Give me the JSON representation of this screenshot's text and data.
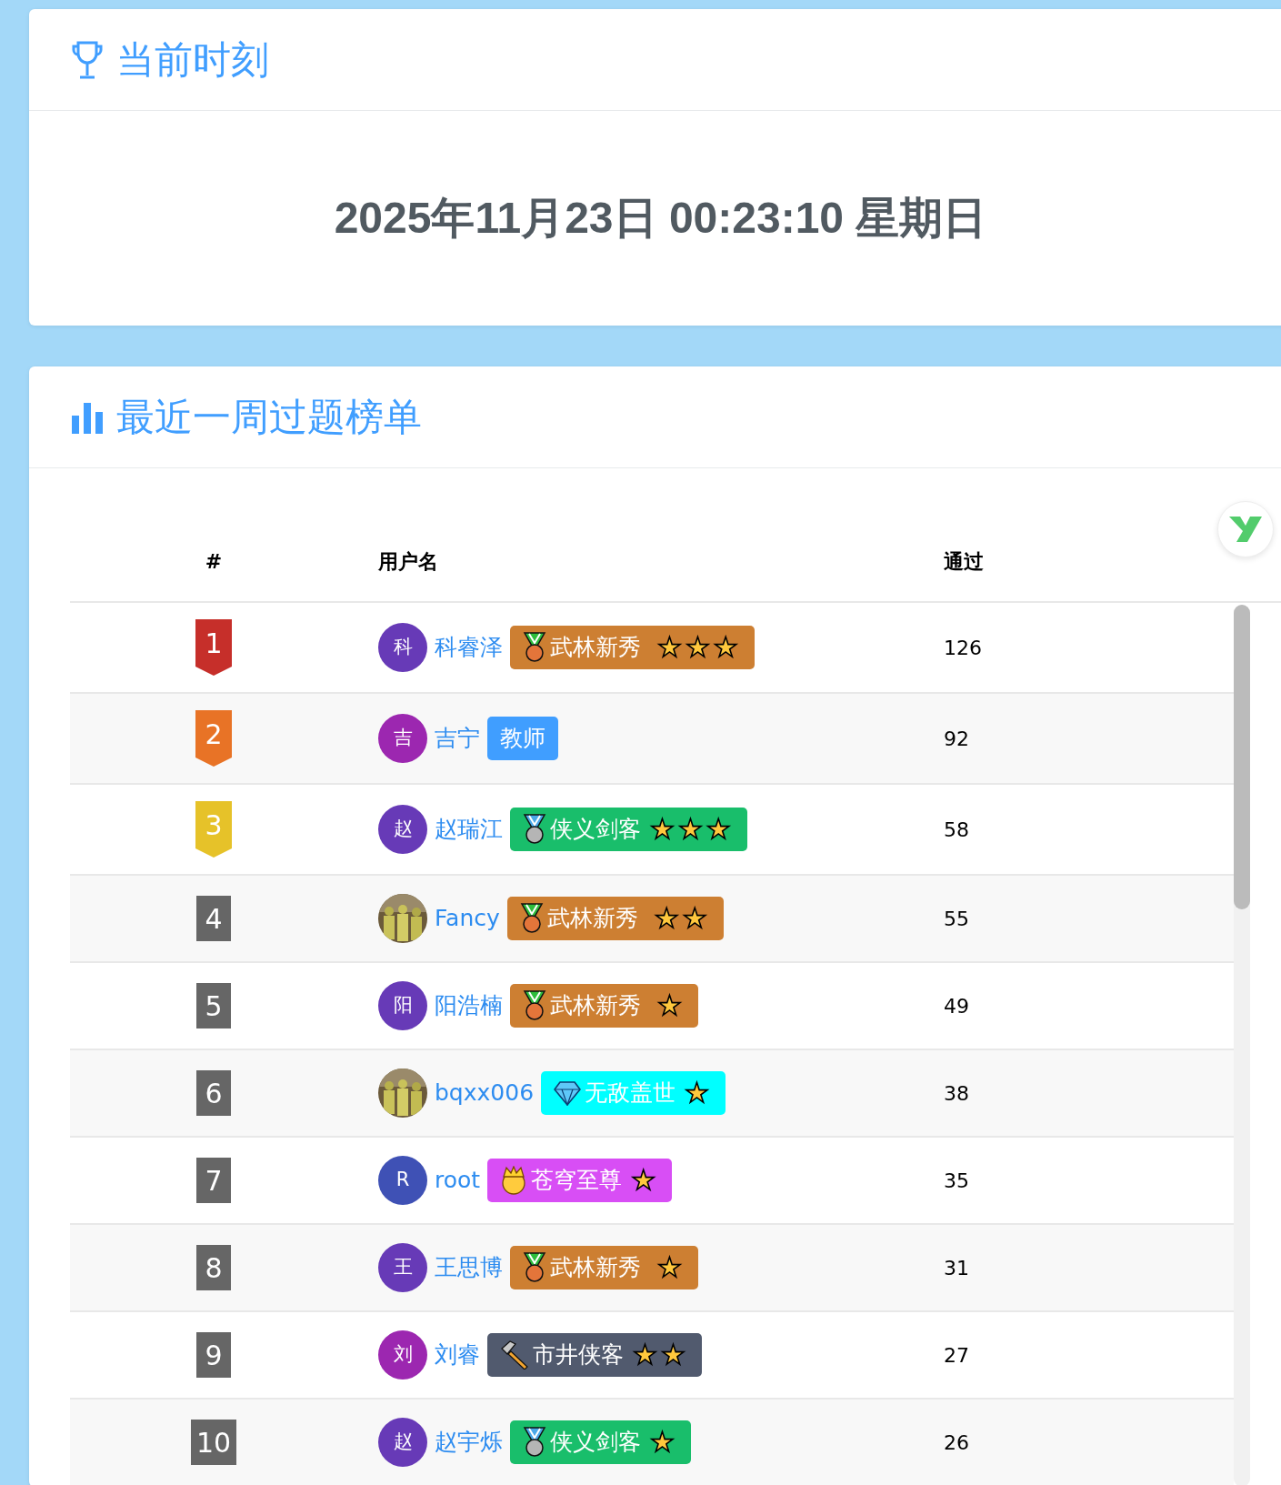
{
  "clock_card": {
    "title": "当前时刻",
    "datetime": "2025年11月23日 00:23:10 星期日"
  },
  "ranking_card": {
    "title": "最近一周过题榜单",
    "table": {
      "columns": [
        "#",
        "用户名",
        "通过"
      ],
      "rows": [
        {
          "rank": {
            "text": "1",
            "kind": "ribbon",
            "color": "#c62f2a"
          },
          "avatar": {
            "kind": "letter",
            "text": "科",
            "color": "#673ab7"
          },
          "username": "科睿泽",
          "badge": {
            "kind": "bronze",
            "text": "武林新秀",
            "color": "#cd7f32",
            "star_marks": "★★★"
          },
          "passed": "126"
        },
        {
          "rank": {
            "text": "2",
            "kind": "ribbon",
            "color": "#e87326"
          },
          "avatar": {
            "kind": "letter",
            "text": "吉",
            "color": "#9c27b0"
          },
          "username": "吉宁",
          "badge": {
            "kind": "plain",
            "text": "教师",
            "color": "#409eff"
          },
          "passed": "92"
        },
        {
          "rank": {
            "text": "3",
            "kind": "ribbon",
            "color": "#e6c229"
          },
          "avatar": {
            "kind": "letter",
            "text": "赵",
            "color": "#673ab7"
          },
          "username": "赵瑞江",
          "badge": {
            "kind": "silver",
            "text": "侠义剑客",
            "color": "#19be6b",
            "star_marks": "★★★"
          },
          "passed": "58"
        },
        {
          "rank": {
            "text": "4",
            "kind": "box",
            "color": "#666666"
          },
          "username": "Fancy",
          "badge": {
            "kind": "bronze",
            "text": "武林新秀",
            "color": "#cd7f32",
            "star_marks": "★★"
          },
          "passed": "55"
        },
        {
          "rank": {
            "text": "5",
            "kind": "box",
            "color": "#666666"
          },
          "avatar": {
            "kind": "letter",
            "text": "阳",
            "color": "#673ab7"
          },
          "username": "阳浩楠",
          "badge": {
            "kind": "bronze",
            "text": "武林新秀",
            "color": "#cd7f32",
            "star_marks": "★"
          },
          "passed": "49"
        },
        {
          "rank": {
            "text": "6",
            "kind": "box",
            "color": "#666666"
          },
          "username": "bqxx006",
          "badge": {
            "kind": "diamond",
            "text": "无敌盖世",
            "color": "#00ffff",
            "star_marks": "★"
          },
          "passed": "38"
        },
        {
          "rank": {
            "text": "7",
            "kind": "box",
            "color": "#666666"
          },
          "avatar": {
            "kind": "letter",
            "text": "R",
            "color": "#3f51b5"
          },
          "username": "root",
          "badge": {
            "kind": "crown",
            "text": "苍穹至尊",
            "color": "#d84ef5",
            "star_marks": "★"
          },
          "passed": "35"
        },
        {
          "rank": {
            "text": "8",
            "kind": "box",
            "color": "#666666"
          },
          "avatar": {
            "kind": "letter",
            "text": "王",
            "color": "#673ab7"
          },
          "username": "王思博",
          "badge": {
            "kind": "bronze",
            "text": "武林新秀",
            "color": "#cd7f32",
            "star_marks": "★"
          },
          "passed": "31"
        },
        {
          "rank": {
            "text": "9",
            "kind": "box",
            "color": "#666666"
          },
          "avatar": {
            "kind": "letter",
            "text": "刘",
            "color": "#9c27b0"
          },
          "username": "刘睿",
          "badge": {
            "kind": "hammer",
            "text": "市井侠客",
            "color": "#515a6e",
            "star_marks": "★★"
          },
          "passed": "27"
        },
        {
          "rank": {
            "text": "10",
            "kind": "box",
            "color": "#666666"
          },
          "avatar": {
            "kind": "letter",
            "text": "赵",
            "color": "#673ab7"
          },
          "username": "赵宇烁",
          "badge": {
            "kind": "silver",
            "text": "侠义剑客",
            "color": "#19be6b",
            "star_marks": "★"
          },
          "passed": "26"
        }
      ]
    }
  }
}
